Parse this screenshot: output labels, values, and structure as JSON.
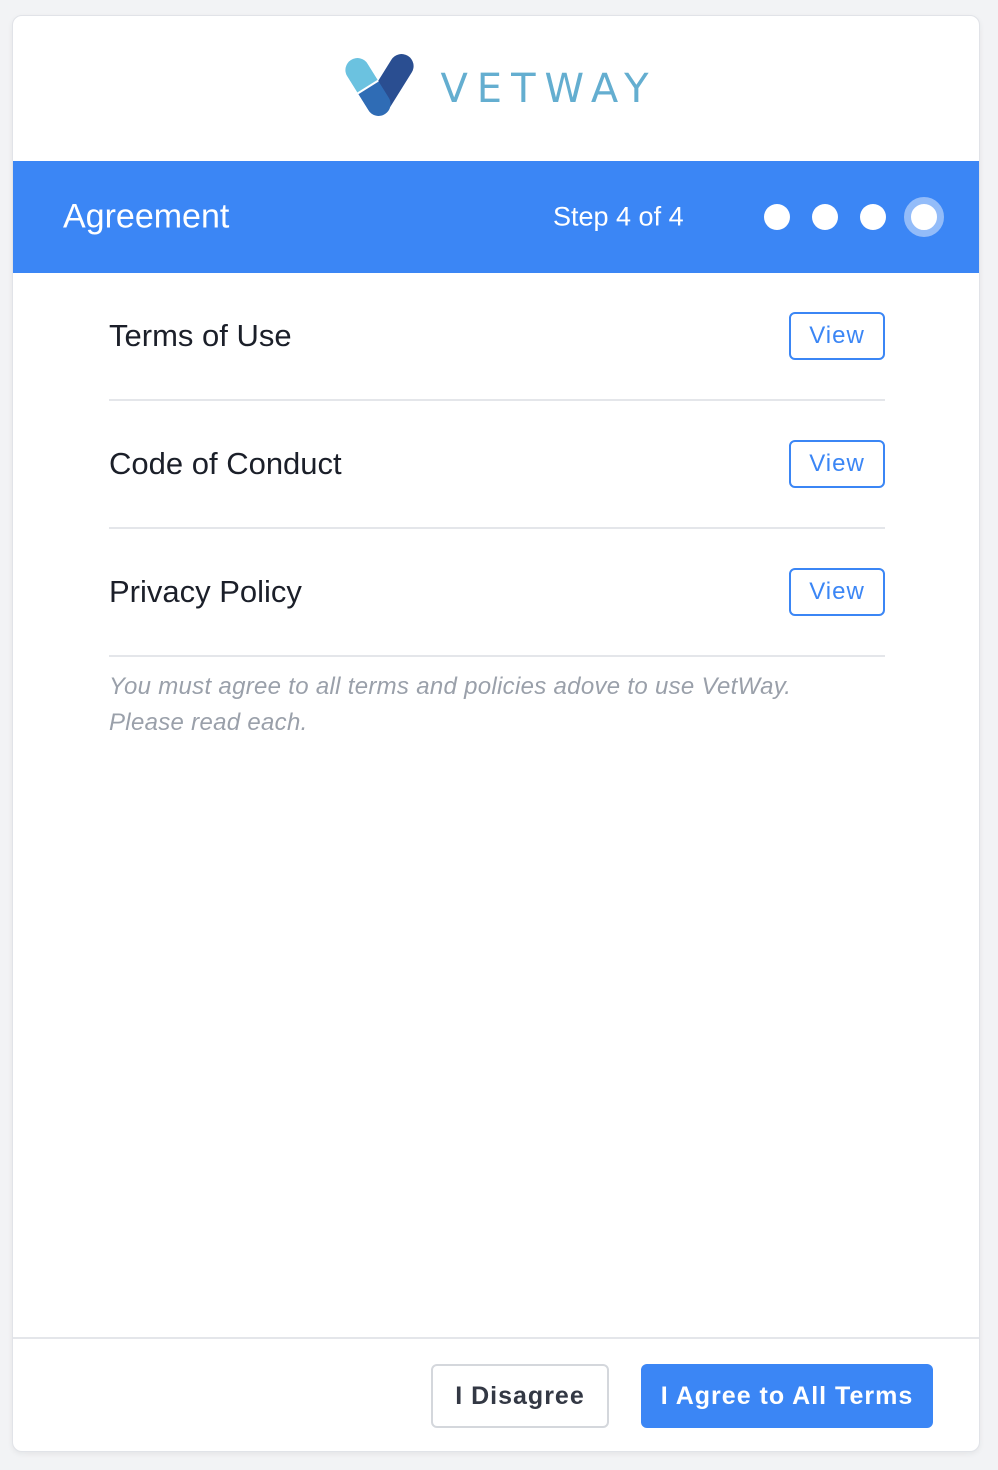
{
  "brand": {
    "name": "VETWAY",
    "logo_icon": "pill-v-logo-icon",
    "text_color": "#64aed0"
  },
  "header": {
    "title": "Agreement",
    "step_label": "Step 4 of 4",
    "total_steps": 4,
    "current_step": 4,
    "background": "#3b86f5"
  },
  "documents": [
    {
      "label": "Terms of Use",
      "action_label": "View"
    },
    {
      "label": "Code of Conduct",
      "action_label": "View"
    },
    {
      "label": "Privacy Policy",
      "action_label": "View"
    }
  ],
  "note": {
    "line1": "You must agree to all terms and policies adove to use VetWay.",
    "line2": "Please read each."
  },
  "footer": {
    "disagree_label": "I Disagree",
    "agree_label": "I Agree to All Terms"
  }
}
